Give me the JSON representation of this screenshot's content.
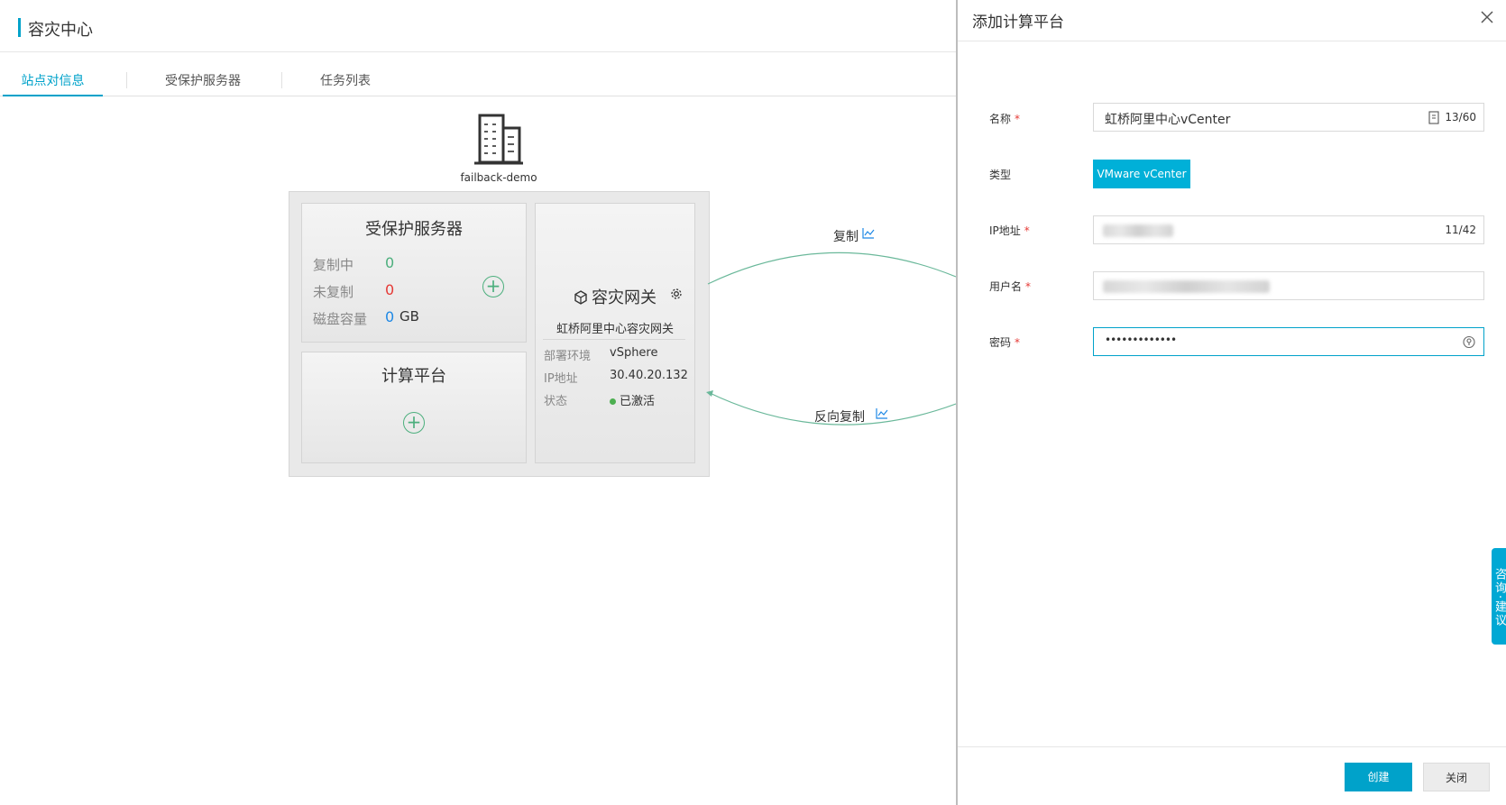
{
  "header": {
    "title": "容灾中心"
  },
  "tabs": [
    {
      "label": "站点对信息"
    },
    {
      "label": "受保护服务器"
    },
    {
      "label": "任务列表"
    }
  ],
  "site": {
    "name": "failback-demo",
    "protected": {
      "title": "受保护服务器",
      "replicating_label": "复制中",
      "replicating_value": "0",
      "unreplicated_label": "未复制",
      "unreplicated_value": "0",
      "disk_label": "磁盘容量",
      "disk_value": "0",
      "disk_unit": "GB"
    },
    "compute": {
      "title": "计算平台"
    },
    "gateway": {
      "title": "容灾网关",
      "subtitle": "虹桥阿里中心容灾网关",
      "env_label": "部署环境",
      "env_value": "vSphere",
      "ip_label": "IP地址",
      "ip_value": "30.40.20.132",
      "status_label": "状态",
      "status_value": "已激活"
    }
  },
  "flows": {
    "replicate_label": "复制",
    "reverse_label": "反向复制"
  },
  "drawer": {
    "title": "添加计算平台",
    "fields": {
      "name_label": "名称",
      "name_value": "虹桥阿里中心vCenter",
      "name_count": "13/60",
      "type_label": "类型",
      "type_value": "VMware vCenter",
      "ip_label": "IP地址",
      "ip_count": "11/42",
      "user_label": "用户名",
      "password_label": "密码",
      "password_value": "•••••••••••••"
    },
    "create_label": "创建",
    "close_label": "关闭"
  },
  "float_tab": {
    "label": "咨询·建议"
  },
  "colors": {
    "accent": "#00a2ca",
    "success": "#4caf7d",
    "danger": "#e53935",
    "link_blue": "#1e88e5"
  },
  "icons": [
    "building-icon",
    "plus-circle-icon",
    "gateway-icon",
    "gear-icon",
    "trend-chart-icon",
    "close-icon",
    "counter-icon",
    "eye-icon"
  ]
}
